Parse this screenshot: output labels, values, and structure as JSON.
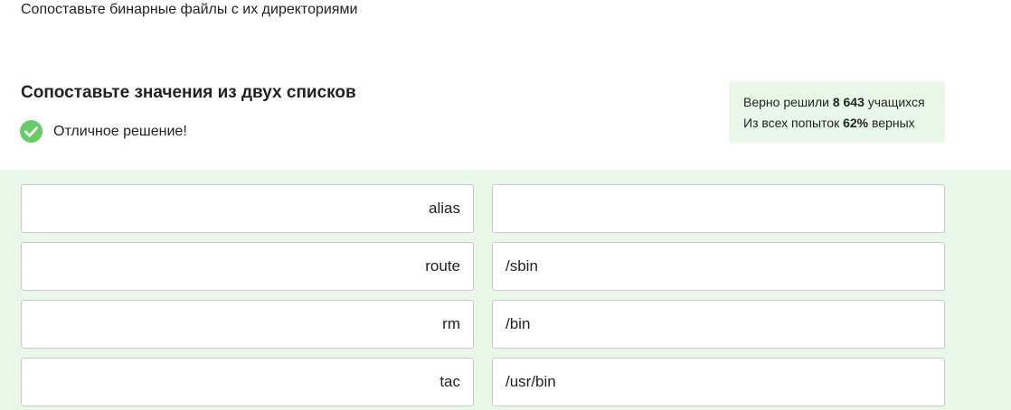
{
  "task": {
    "text": "Сопоставьте бинарные файлы с их директориями"
  },
  "quiz": {
    "title": "Сопоставьте значения из двух списков",
    "result_text": "Отличное решение!",
    "result_icon": "check-circle-icon",
    "accent_color": "#66cc66"
  },
  "stats": {
    "line1_prefix": "Верно решили ",
    "line1_value": "8 643",
    "line1_suffix": " учащихся",
    "line2_prefix": "Из всех попыток ",
    "line2_value": "62%",
    "line2_suffix": " верных"
  },
  "matching": {
    "rows": [
      {
        "left": "alias",
        "right": ""
      },
      {
        "left": "route",
        "right": "/sbin"
      },
      {
        "left": "rm",
        "right": "/bin"
      },
      {
        "left": "tac",
        "right": "/usr/bin"
      }
    ]
  }
}
